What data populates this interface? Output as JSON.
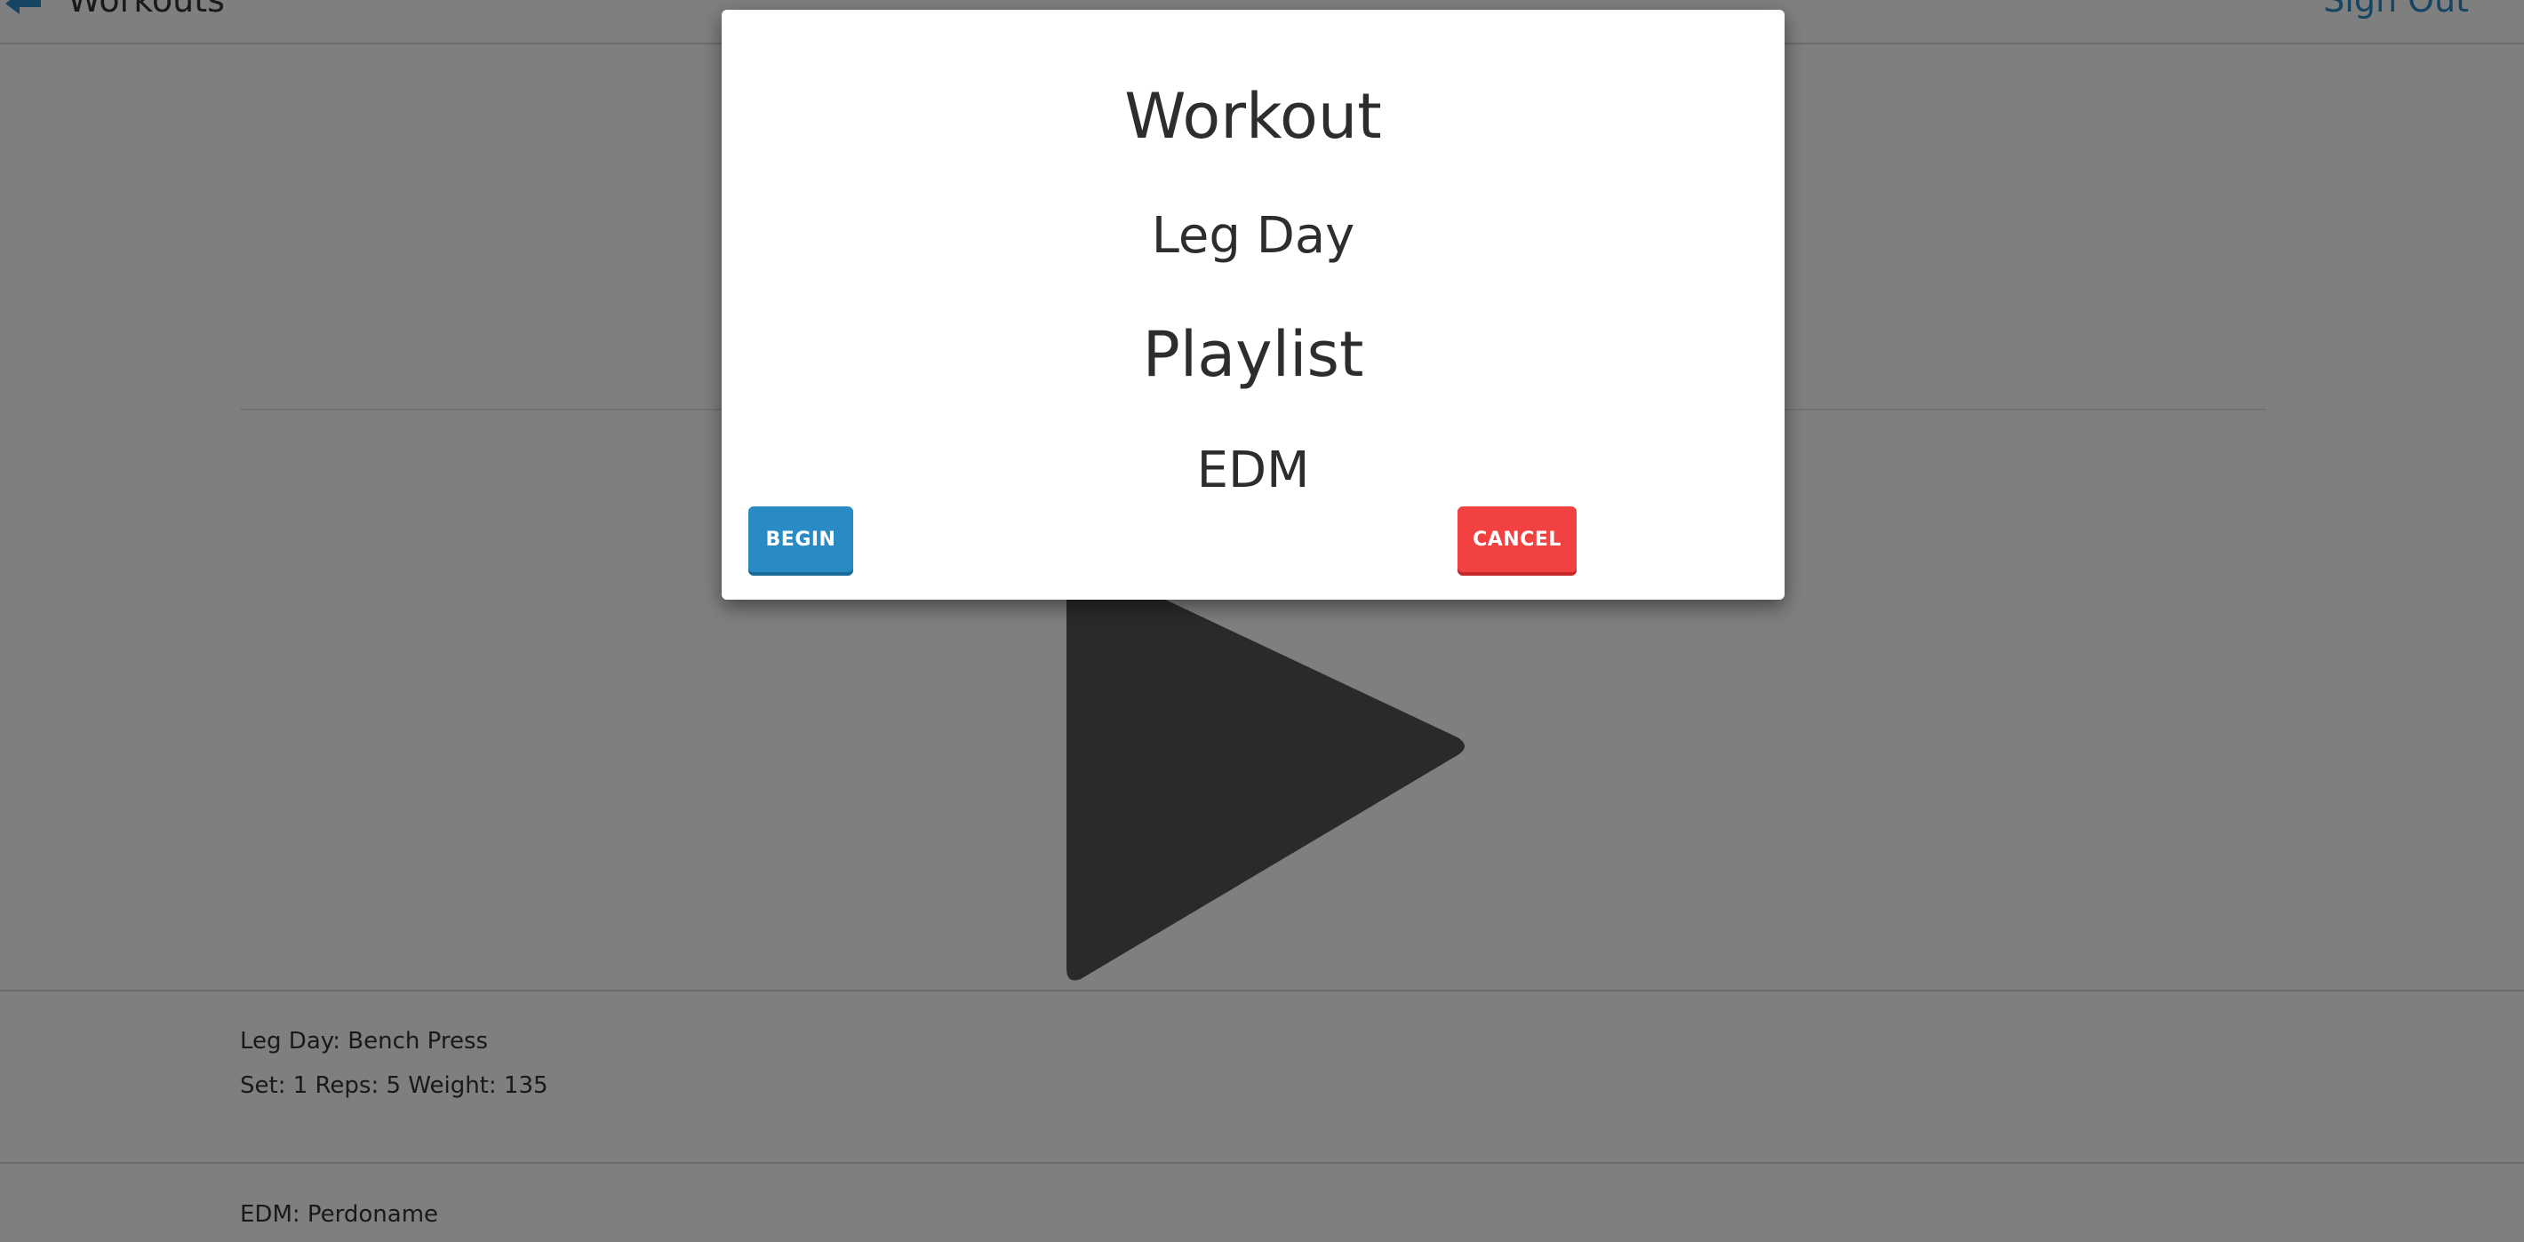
{
  "header": {
    "back_label": "Workouts",
    "sign_out_label": "Sign Out"
  },
  "now_playing": {
    "exercise_title": "Leg Day: Bench Press",
    "exercise_stats": "Set: 1 Reps: 5 Weight: 135",
    "track": "EDM: Perdoname"
  },
  "modal": {
    "workout_heading": "Workout",
    "workout_value": "Leg Day",
    "playlist_heading": "Playlist",
    "playlist_value": "EDM",
    "begin_label": "BEGIN",
    "cancel_label": "CANCEL"
  },
  "icons": {
    "back": "back-arrow-icon",
    "play": "play-icon"
  },
  "colors": {
    "accent": "#2a8ac4",
    "danger": "#f24141",
    "overlay": "#808080",
    "text": "#333333"
  }
}
